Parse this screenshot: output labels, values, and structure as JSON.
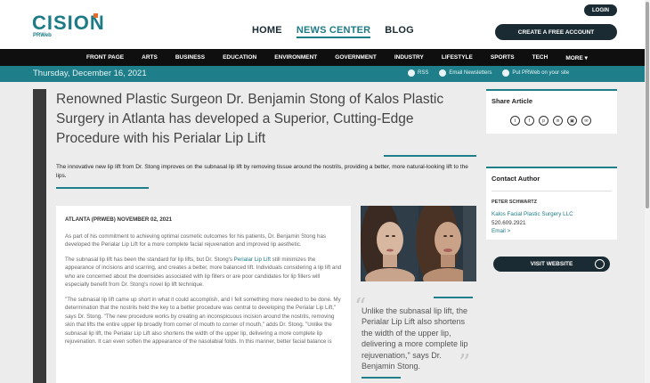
{
  "brand": {
    "name": "CISION",
    "sub": "PRWeb"
  },
  "topnav": [
    {
      "label": "HOME",
      "active": false
    },
    {
      "label": "NEWS CENTER",
      "active": true
    },
    {
      "label": "BLOG",
      "active": false
    }
  ],
  "login_label": "LOGIN",
  "create_account_label": "CREATE A FREE ACCOUNT",
  "categories": [
    "FRONT PAGE",
    "ARTS",
    "BUSINESS",
    "EDUCATION",
    "ENVIRONMENT",
    "GOVERNMENT",
    "INDUSTRY",
    "LIFESTYLE",
    "SPORTS",
    "TECH",
    "MORE ▾"
  ],
  "datebar": {
    "date": "Thursday, December 16, 2021",
    "rss": "RSS",
    "email": "Email Newsletters",
    "put": "Put PRWeb on your site"
  },
  "article": {
    "title": "Renowned Plastic Surgeon Dr. Benjamin Stong of Kalos Plastic Surgery in Atlanta has developed a Superior, Cutting-Edge Procedure with his Perialar Lip Lift",
    "summary": "The innovative new lip lift from Dr. Stong improves on the subnasal lip lift by removing tissue around the nostrils, providing a better, more natural-looking lift to the lips.",
    "dateline": "ATLANTA (PRWEB) NOVEMBER 02, 2021",
    "p1": "As part of his commitment to achieving optimal cosmetic outcomes for his patients, Dr. Benjamin Stong has developed the Perialar Lip Lift for a more complete facial rejuvenation and improved lip aesthetic.",
    "p2_pre": "The subnasal lip lift has been the standard for lip lifts, but Dr. Stong's ",
    "p2_link": "Perialar Lip Lift",
    "p2_post": " still minimizes the appearance of incisions and scarring, and creates a better, more balanced lift. Individuals considering a lip lift and who are concerned about the downsides associated with lip fillers or are poor candidates for lip fillers will especially benefit from Dr. Stong's novel lip lift technique.",
    "p3": "\"The subnasal lip lift came up short in what it could accomplish, and I felt something more needed to be done. My determination that the nostrils held the key to a better procedure was central to developing the Perialar Lip Lift,\" says Dr. Stong. \"The new procedure works by creating an inconspicuous incision around the nostrils, removing skin that lifts the entire upper lip broadly from corner of mouth to corner of mouth,\" adds Dr. Stong. \"Unlike the subnasal lip lift, the Perialar Lip Lift also shortens the width of the upper lip, delivering a more complete lip rejuvenation. It can even soften the appearance of the nasolabial folds. In this manner, better facial balance is",
    "quote": "Unlike the subnasal lip lift, the Perialar Lip Lift also shortens the width of the upper lip, delivering a more complete lip rejuvenation,\" says Dr. Benjamin Stong."
  },
  "sidebar": {
    "share_title": "Share Article",
    "share_icons": [
      "twitter-icon",
      "facebook-icon",
      "pinterest-icon",
      "linkedin-icon",
      "print-icon",
      "email-icon"
    ],
    "contact_title": "Contact Author",
    "author": "PETER SCHWARTZ",
    "org": "Kalos Facial Plastic Surgery LLC",
    "phone": "520.609.2921",
    "email": "Email >",
    "visit_label": "VISIT WEBSITE"
  },
  "colors": {
    "accent": "#1e7f8a",
    "dark": "#1b2b33",
    "nav": "#0f0f0f"
  }
}
